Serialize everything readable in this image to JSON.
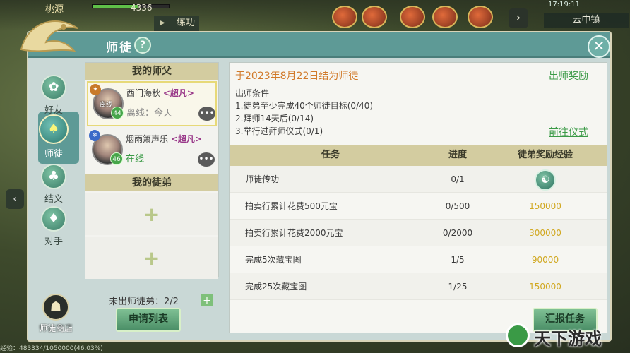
{
  "hud": {
    "player_name": "桃源",
    "hp_value": "4336",
    "practice": "练功",
    "time": "17:19:11",
    "location": "云中镇",
    "exp": "经验：483334/1050000(46.03%)"
  },
  "dialog": {
    "title": "师徒",
    "help": "?",
    "close": "✕"
  },
  "nav": {
    "items": [
      {
        "label": "好友",
        "icon": "✿"
      },
      {
        "label": "师徒",
        "icon": "♠"
      },
      {
        "label": "结义",
        "icon": "♣"
      },
      {
        "label": "对手",
        "icon": "♦"
      }
    ],
    "shop_label": "师徒商店",
    "shop_icon": "☗"
  },
  "master_section": {
    "title": "我的师父",
    "masters": [
      {
        "name": "西门海秋",
        "tag": "<超凡>",
        "status": "离线：今天",
        "level": "44",
        "type_icon": "✦",
        "offline_tag": "离线"
      },
      {
        "name": "烟雨箫声乐",
        "tag": "<超凡>",
        "status": "在线",
        "level": "46",
        "type_icon": "❄"
      }
    ]
  },
  "apprentice_section": {
    "title": "我的徒弟",
    "slot_plus": "+",
    "free_count": "未出师徒弟：2/2",
    "add": "+",
    "apply_button": "申请列表"
  },
  "relation": {
    "date_text": "于2023年8月22日结为师徒",
    "reward_link": "出师奖励",
    "conditions_title": "出师条件",
    "conditions": [
      "1.徒弟至少完成40个师徒目标(0/40)",
      "2.拜师14天后(0/14)",
      "3.举行过拜师仪式(0/1)"
    ],
    "ceremony_link": "前往仪式"
  },
  "tasks": {
    "headers": [
      "任务",
      "进度",
      "徒弟奖励经验"
    ],
    "rows": [
      {
        "task": "师徒传功",
        "progress": "0/1",
        "reward": "",
        "reward_icon": "☯"
      },
      {
        "task": "拍卖行累计花费500元宝",
        "progress": "0/500",
        "reward": "150000"
      },
      {
        "task": "拍卖行累计花费2000元宝",
        "progress": "0/2000",
        "reward": "300000"
      },
      {
        "task": "完成5次藏宝图",
        "progress": "1/5",
        "reward": "90000"
      },
      {
        "task": "完成25次藏宝图",
        "progress": "1/25",
        "reward": "150000"
      }
    ]
  },
  "report_button": "汇报任务",
  "watermark": "天下游戏"
}
